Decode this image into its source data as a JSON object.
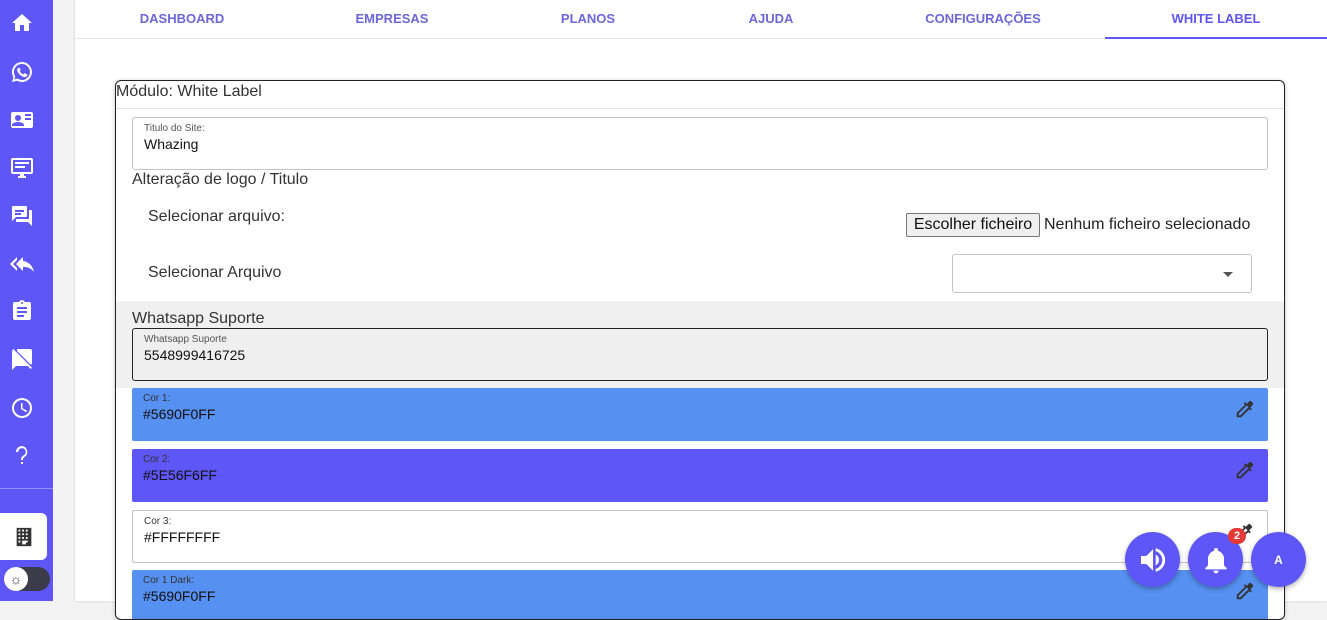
{
  "sidebar": {
    "items": [
      {
        "icon": "home-icon"
      },
      {
        "icon": "whatsapp-icon"
      },
      {
        "icon": "contact-card-icon"
      },
      {
        "icon": "desktop-icon"
      },
      {
        "icon": "chat-icon"
      },
      {
        "icon": "reply-all-icon"
      },
      {
        "icon": "clipboard-icon"
      },
      {
        "icon": "announcement-off-icon"
      },
      {
        "icon": "clock-icon"
      },
      {
        "icon": "help-icon"
      }
    ],
    "company_icon": "building-icon",
    "theme_icon": "sun-icon"
  },
  "tabs": [
    {
      "label": "DASHBOARD",
      "active": false
    },
    {
      "label": "EMPRESAS",
      "active": false
    },
    {
      "label": "PLANOS",
      "active": false
    },
    {
      "label": "AJUDA",
      "active": false
    },
    {
      "label": "CONFIGURAÇÕES",
      "active": false
    },
    {
      "label": "WHITE LABEL",
      "active": true
    }
  ],
  "card": {
    "title": "Módulo: White Label",
    "site_title": {
      "label": "Titulo do Site:",
      "value": "Whazing"
    },
    "logo_section": "Alteração de logo / Titulo",
    "select_file_label": "Selecionar arquivo:",
    "file_button": "Escolher ficheiro",
    "file_status": "Nenhum ficheiro selecionado",
    "select_file2_label": "Selecionar Arquivo",
    "select_file2_value": "",
    "whatsapp_section": "Whatsapp Suporte",
    "whatsapp": {
      "label": "Whatsapp Suporte",
      "value": "5548999416725"
    },
    "colors": [
      {
        "label": "Cor 1:",
        "value": "#5690F0FF",
        "bg": "#5690F0"
      },
      {
        "label": "Cor 2:",
        "value": "#5E56F6FF",
        "bg": "#5E56F6"
      },
      {
        "label": "Cor 3:",
        "value": "#FFFFFFFF",
        "bg": "#FFFFFF"
      },
      {
        "label": "Cor 1 Dark:",
        "value": "#5690F0FF",
        "bg": "#5690F0"
      }
    ]
  },
  "notifications": {
    "count": "2"
  },
  "user": {
    "initial": "A"
  },
  "colors": {
    "primary": "#5E56F6",
    "accent_blue": "#5690F0",
    "badge": "#E53935"
  }
}
